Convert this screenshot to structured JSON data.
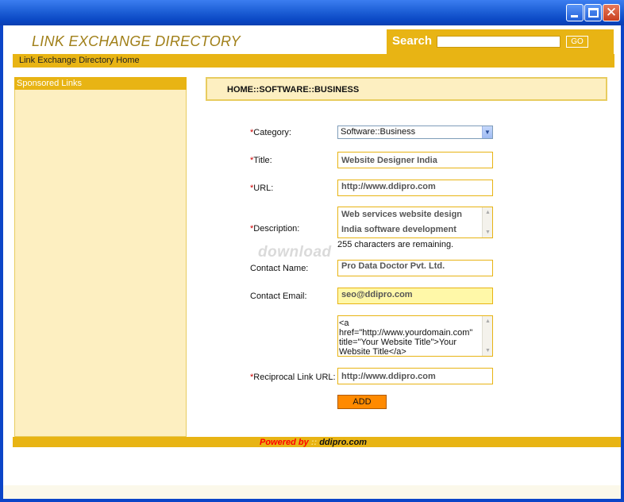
{
  "window": {
    "controls": [
      "minimize",
      "maximize",
      "close"
    ],
    "close_glyph": "✕"
  },
  "header": {
    "title": "LINK EXCHANGE DIRECTORY",
    "search_label": "Search",
    "search_value": "",
    "go_label": "GO",
    "nav_home": "Link Exchange Directory Home"
  },
  "sidebar": {
    "title": "Sponsored Links"
  },
  "breadcrumb": "HOME::SOFTWARE::BUSINESS",
  "form": {
    "required_mark": "*",
    "category": {
      "label": "Category:",
      "value": "Software::Business"
    },
    "title": {
      "label": "Title:",
      "value": "Website Designer India"
    },
    "url": {
      "label": "URL:",
      "value": "http://www.ddipro.com"
    },
    "description": {
      "label": "Description:",
      "lines": [
        "Web services website design",
        "India software development"
      ],
      "remaining": "255 characters are remaining."
    },
    "contact_name": {
      "label": "Contact Name:",
      "value": "Pro Data Doctor Pvt. Ltd."
    },
    "contact_email": {
      "label": "Contact Email:",
      "value": "seo@ddipro.com"
    },
    "link_code": "<a href=\"http://www.yourdomain.com\" title=\"Your Website Title\">Your Website Title</a>",
    "reciprocal": {
      "label": "Reciprocal Link URL:",
      "value": "http://www.ddipro.com"
    },
    "add_label": "ADD"
  },
  "watermark": "download",
  "footer": {
    "powered_by": "Powered by",
    "dots": "::",
    "site": "ddipro.com"
  },
  "colors": {
    "accent": "#e8b414",
    "panel": "#fdefc1",
    "button": "#ff8a00",
    "required": "#cc0000",
    "title_bar": "#1d5fd6"
  }
}
